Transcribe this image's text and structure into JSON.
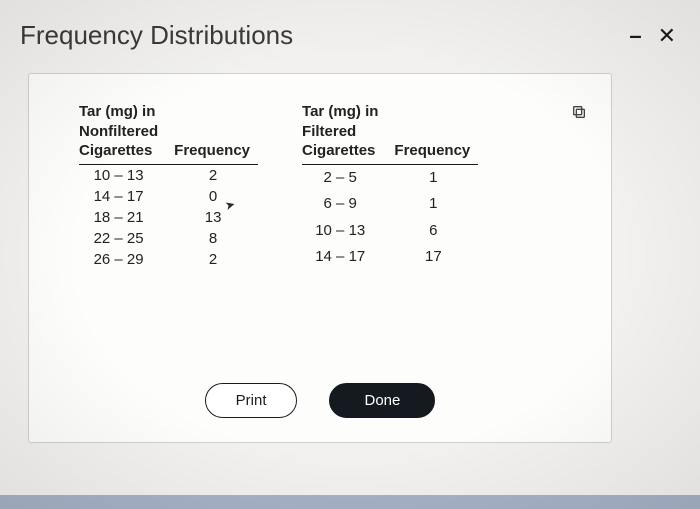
{
  "title": "Frequency Distributions",
  "table1": {
    "header_col1_l1": "Tar (mg) in",
    "header_col1_l2": "Nonfiltered",
    "header_col1_l3": "Cigarettes",
    "header_col2": "Frequency",
    "rows": [
      {
        "range": "10 – 13",
        "freq": "2"
      },
      {
        "range": "14 – 17",
        "freq": "0"
      },
      {
        "range": "18 – 21",
        "freq": "13"
      },
      {
        "range": "22 – 25",
        "freq": "8"
      },
      {
        "range": "26 – 29",
        "freq": "2"
      }
    ]
  },
  "table2": {
    "header_col1_l1": "Tar (mg) in",
    "header_col1_l2": "Filtered",
    "header_col1_l3": "Cigarettes",
    "header_col2": "Frequency",
    "rows": [
      {
        "range": "2 – 5",
        "freq": "1"
      },
      {
        "range": "6 – 9",
        "freq": "1"
      },
      {
        "range": "10 – 13",
        "freq": "6"
      },
      {
        "range": "14 – 17",
        "freq": "17"
      }
    ]
  },
  "buttons": {
    "print": "Print",
    "done": "Done"
  }
}
